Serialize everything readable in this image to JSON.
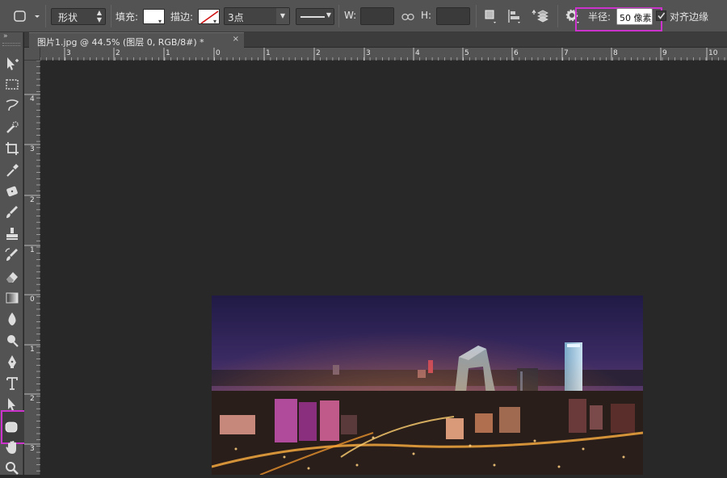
{
  "options_bar": {
    "mode": "形状",
    "fill_label": "填充:",
    "stroke_label": "描边:",
    "stroke_width": "3点",
    "w_label": "W:",
    "h_label": "H:",
    "radius_label": "半径:",
    "radius_value": "50 像素",
    "align_edges_label": "对齐边缘",
    "fill_color": "#ffffff",
    "highlight_color": "#cc33cc"
  },
  "document": {
    "tab_title": "图片1.jpg @ 44.5% (图层 0, RGB/8#) *",
    "close_glyph": "×"
  },
  "rulers": {
    "horizontal": [
      "3",
      "2",
      "1",
      "0",
      "1",
      "2",
      "3",
      "4",
      "5",
      "6",
      "7",
      "8",
      "9",
      "10"
    ],
    "vertical": [
      "4",
      "3",
      "2",
      "1",
      "0",
      "1",
      "2",
      "3"
    ]
  },
  "tools": [
    {
      "name": "move-tool-icon"
    },
    {
      "name": "rectangular-marquee-icon"
    },
    {
      "name": "lasso-icon"
    },
    {
      "name": "quick-selection-icon"
    },
    {
      "name": "crop-icon"
    },
    {
      "name": "eyedropper-icon"
    },
    {
      "name": "spot-healing-icon"
    },
    {
      "name": "brush-icon"
    },
    {
      "name": "clone-stamp-icon"
    },
    {
      "name": "history-brush-icon"
    },
    {
      "name": "eraser-icon"
    },
    {
      "name": "gradient-icon"
    },
    {
      "name": "blur-icon"
    },
    {
      "name": "dodge-icon"
    },
    {
      "name": "pen-icon"
    },
    {
      "name": "type-icon"
    },
    {
      "name": "path-selection-icon"
    },
    {
      "name": "rounded-rectangle-icon",
      "active": true
    },
    {
      "name": "hand-icon"
    },
    {
      "name": "zoom-icon"
    }
  ]
}
